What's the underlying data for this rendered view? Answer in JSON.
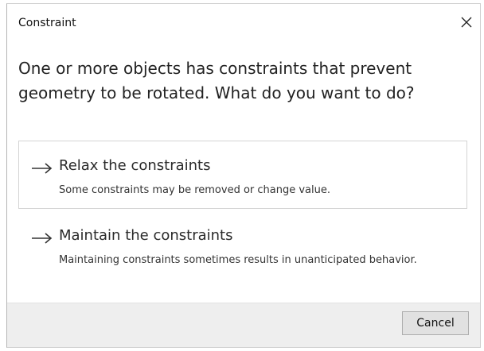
{
  "window": {
    "title": "Constraint",
    "close_icon": "close-icon"
  },
  "message": "One or more objects has constraints that prevent geometry to be rotated. What do you want to do?",
  "options": [
    {
      "icon": "arrow-right-icon",
      "title": "Relax the constraints",
      "description": "Some constraints may be removed or change value."
    },
    {
      "icon": "arrow-right-icon",
      "title": "Maintain the constraints",
      "description": "Maintaining constraints sometimes results in unanticipated behavior."
    }
  ],
  "footer": {
    "cancel_label": "Cancel"
  },
  "colors": {
    "footer_background": "#eeeeee",
    "button_background": "#e1e1e1",
    "text": "#222222"
  }
}
